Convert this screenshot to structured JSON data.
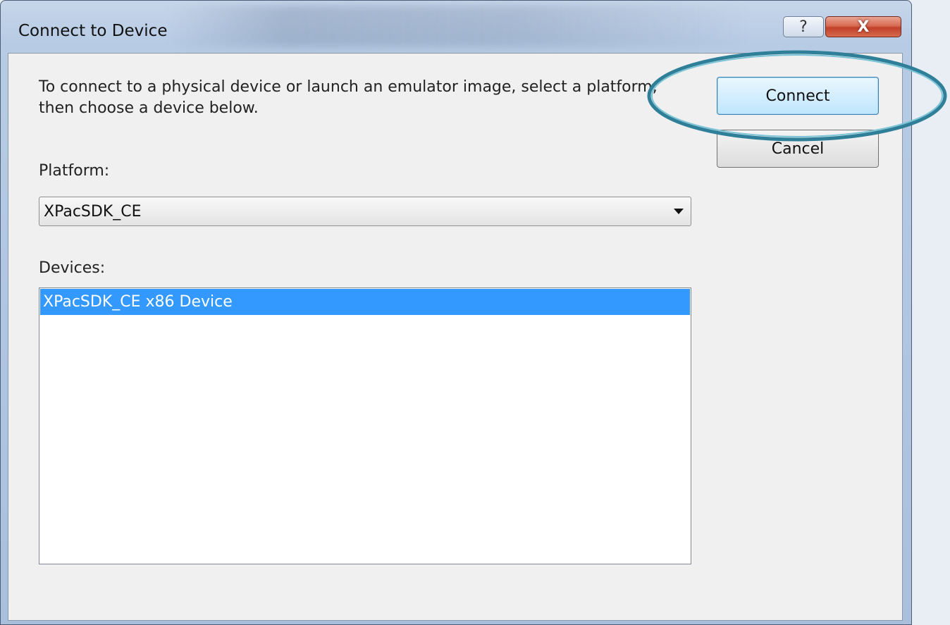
{
  "window": {
    "title": "Connect to Device",
    "help_glyph": "?",
    "close_glyph": "X"
  },
  "dialog": {
    "instructions": "To connect to a physical device or launch an emulator image, select a platform, then choose a device below.",
    "platform_label": "Platform:",
    "platform_value": "XPacSDK_CE",
    "devices_label": "Devices:",
    "devices": [
      {
        "label": "XPacSDK_CE x86 Device",
        "selected": true
      }
    ],
    "connect_label": "Connect",
    "cancel_label": "Cancel"
  },
  "colors": {
    "selection": "#3399ff",
    "callout": "#4a9db5",
    "close_button": "#c2402b"
  },
  "icons": [
    "help-icon",
    "close-icon",
    "dropdown-arrow-icon"
  ]
}
